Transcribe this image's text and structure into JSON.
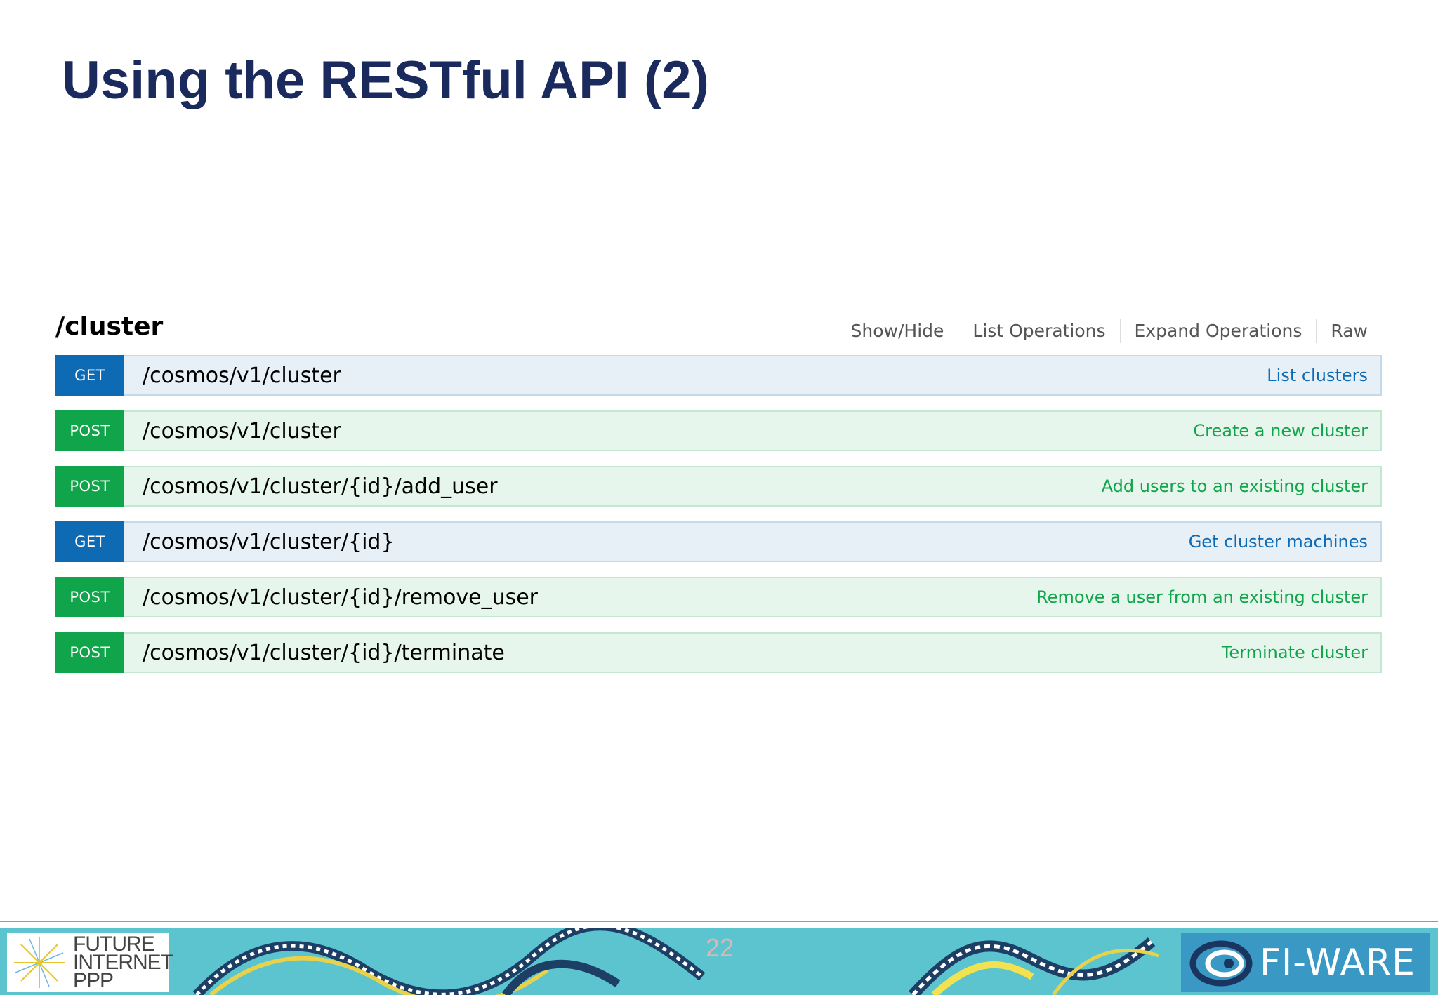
{
  "slide": {
    "title": "Using the RESTful API (2)",
    "page_number": "22"
  },
  "resource": {
    "name": "/cluster",
    "options": {
      "show_hide": "Show/Hide",
      "list_operations": "List Operations",
      "expand_operations": "Expand Operations",
      "raw": "Raw"
    },
    "operations": [
      {
        "method": "GET",
        "path": "/cosmos/v1/cluster",
        "summary": "List clusters"
      },
      {
        "method": "POST",
        "path": "/cosmos/v1/cluster",
        "summary": "Create a new cluster"
      },
      {
        "method": "POST",
        "path": "/cosmos/v1/cluster/{id}/add_user",
        "summary": "Add users to an existing cluster"
      },
      {
        "method": "GET",
        "path": "/cosmos/v1/cluster/{id}",
        "summary": "Get cluster machines"
      },
      {
        "method": "POST",
        "path": "/cosmos/v1/cluster/{id}/remove_user",
        "summary": "Remove a user from an existing cluster"
      },
      {
        "method": "POST",
        "path": "/cosmos/v1/cluster/{id}/terminate",
        "summary": "Terminate cluster"
      }
    ]
  },
  "footer": {
    "fi_ppp_logo_lines": [
      "FUTURE",
      "INTERNET",
      "PPP"
    ],
    "fiware_logo_text": "FI-WARE",
    "icons": [
      "fi-ppp-starburst-icon",
      "fiware-swirl-icon"
    ]
  },
  "colors": {
    "title": "#1b2a5c",
    "get": "#0f6ab4",
    "post": "#10a54a",
    "get_row_bg": "#e7f0f7",
    "post_row_bg": "#e7f6ec",
    "footer_band": "#5bc4cf",
    "fiware_logo_bg": "#3a99c4"
  }
}
